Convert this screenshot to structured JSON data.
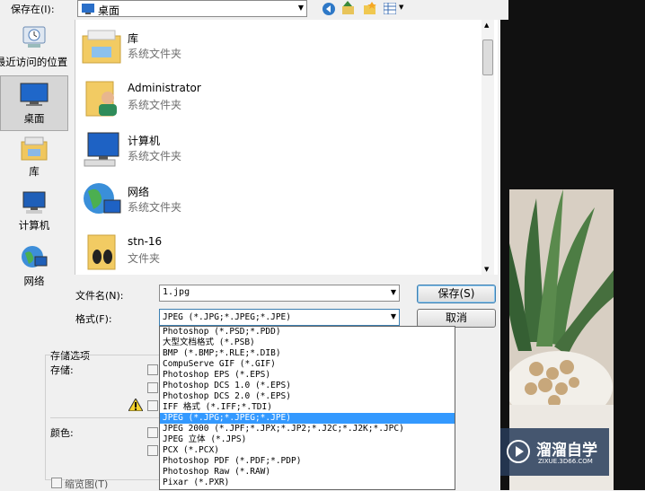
{
  "save_in": {
    "label": "保存在(I):",
    "value": "桌面"
  },
  "sidebar": {
    "items": [
      {
        "label": "最近访问的位置",
        "icon": "recent-places-icon"
      },
      {
        "label": "桌面",
        "icon": "desktop-icon",
        "selected": true
      },
      {
        "label": "库",
        "icon": "library-icon"
      },
      {
        "label": "计算机",
        "icon": "computer-icon"
      },
      {
        "label": "网络",
        "icon": "network-icon"
      }
    ]
  },
  "files": [
    {
      "name": "库",
      "type": "系统文件夹",
      "icon": "library-folder-icon"
    },
    {
      "name": "Administrator",
      "type": "系统文件夹",
      "icon": "user-folder-icon"
    },
    {
      "name": "计算机",
      "type": "系统文件夹",
      "icon": "computer-icon"
    },
    {
      "name": "网络",
      "type": "系统文件夹",
      "icon": "network-globe-icon"
    },
    {
      "name": "stn-16",
      "type": "文件夹",
      "icon": "folder-icon"
    }
  ],
  "filename": {
    "label": "文件名(N):",
    "value": "1.jpg"
  },
  "format": {
    "label": "格式(F):",
    "value": "JPEG (*.JPG;*.JPEG;*.JPE)"
  },
  "buttons": {
    "save": "保存(S)",
    "cancel": "取消"
  },
  "format_options": [
    "Photoshop (*.PSD;*.PDD)",
    "大型文档格式 (*.PSB)",
    "BMP (*.BMP;*.RLE;*.DIB)",
    "CompuServe GIF (*.GIF)",
    "Photoshop EPS (*.EPS)",
    "Photoshop DCS 1.0 (*.EPS)",
    "Photoshop DCS 2.0 (*.EPS)",
    "IFF 格式 (*.IFF;*.TDI)",
    "JPEG (*.JPG;*.JPEG;*.JPE)",
    "JPEG 2000 (*.JPF;*.JPX;*.JP2;*.J2C;*.J2K;*.JPC)",
    "JPEG 立体 (*.JPS)",
    "PCX (*.PCX)",
    "Photoshop PDF (*.PDF;*.PDP)",
    "Photoshop Raw (*.RAW)",
    "Pixar (*.PXR)"
  ],
  "selected_format_index": 8,
  "storage": {
    "group_title": "存储选项",
    "store_label": "存储:",
    "color_label": "颜色:",
    "thumbnail_label": "缩览图(T)"
  },
  "watermark": {
    "title": "溜溜自学",
    "url": "ZIXUE.3D66.COM"
  },
  "colors": {
    "selection": "#3399ff",
    "dialog_bg": "#f0f0f0",
    "backdrop": "#111111"
  }
}
